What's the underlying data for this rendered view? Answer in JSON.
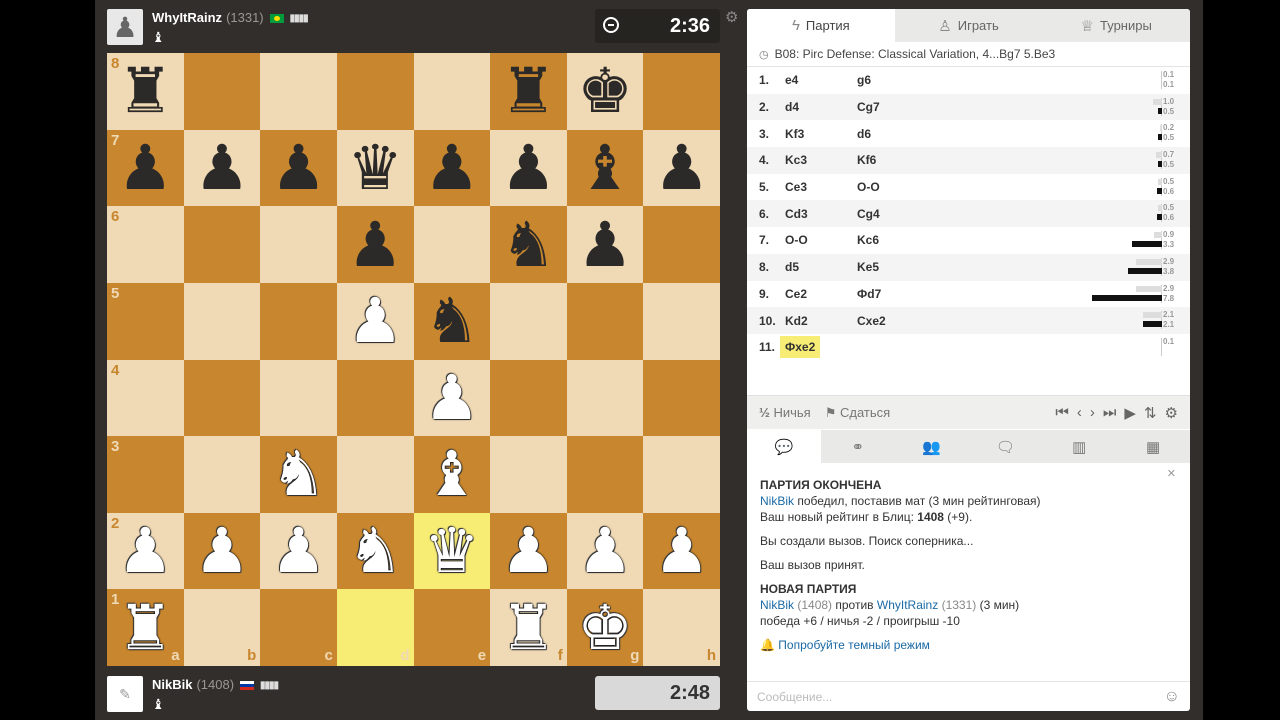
{
  "top_player": {
    "name": "WhyItRainz",
    "rating": "(1331)",
    "clock": "2:36"
  },
  "bottom_player": {
    "name": "NikBik",
    "rating": "(1408)",
    "clock": "2:48"
  },
  "board": {
    "ranks": [
      "8",
      "7",
      "6",
      "5",
      "4",
      "3",
      "2",
      "1"
    ],
    "files": [
      "a",
      "b",
      "c",
      "d",
      "e",
      "f",
      "g",
      "h"
    ],
    "rows": [
      [
        "bR",
        "",
        "",
        "",
        "",
        "bR",
        "bK",
        ""
      ],
      [
        "bP",
        "bP",
        "bP",
        "bQ",
        "bP",
        "bP",
        "bB",
        "bP"
      ],
      [
        "",
        "",
        "",
        "bP",
        "",
        "bN",
        "bP",
        ""
      ],
      [
        "",
        "",
        "",
        "wP",
        "bN",
        "",
        "",
        ""
      ],
      [
        "",
        "",
        "",
        "",
        "wP",
        "",
        "",
        ""
      ],
      [
        "",
        "",
        "wN",
        "",
        "wB",
        "",
        "",
        ""
      ],
      [
        "wP",
        "wP",
        "wP",
        "wN",
        "wQ",
        "wP",
        "wP",
        "wP"
      ],
      [
        "wR",
        "",
        "",
        "",
        "",
        "wR",
        "wK",
        ""
      ]
    ]
  },
  "panel": {
    "tabs": [
      "Партия",
      "Играть",
      "Турниры"
    ],
    "opening": "B08: Pirc Defense: Classical Variation, 4...Bg7 5.Be3",
    "moves": [
      {
        "no": "1.",
        "w": "e4",
        "b": "g6",
        "e1": "0.1",
        "e2": "0.1",
        "bw1": 0,
        "bw2": 0
      },
      {
        "no": "2.",
        "w": "d4",
        "b": "Cg7",
        "e1": "1.0",
        "e2": "0.5",
        "bw1": 10,
        "bw2": 5
      },
      {
        "no": "3.",
        "w": "Kf3",
        "b": "d6",
        "e1": "0.2",
        "e2": "0.5",
        "bw1": 2,
        "bw2": 5
      },
      {
        "no": "4.",
        "w": "Kc3",
        "b": "Kf6",
        "e1": "0.7",
        "e2": "0.5",
        "bw1": 7,
        "bw2": 5
      },
      {
        "no": "5.",
        "w": "Ce3",
        "b": "O-O",
        "e1": "0.5",
        "e2": "0.6",
        "bw1": 5,
        "bw2": 6
      },
      {
        "no": "6.",
        "w": "Cd3",
        "b": "Cg4",
        "e1": "0.5",
        "e2": "0.6",
        "bw1": 5,
        "bw2": 6
      },
      {
        "no": "7.",
        "w": "O-O",
        "b": "Kc6",
        "e1": "0.9",
        "e2": "3.3",
        "bw1": 9,
        "bw2": 33
      },
      {
        "no": "8.",
        "w": "d5",
        "b": "Ke5",
        "e1": "2.9",
        "e2": "3.8",
        "bw1": 29,
        "bw2": 38
      },
      {
        "no": "9.",
        "w": "Ce2",
        "b": "Фd7",
        "e1": "2.9",
        "e2": "7.8",
        "bw1": 29,
        "bw2": 78
      },
      {
        "no": "10.",
        "w": "Kd2",
        "b": "Cxe2",
        "e1": "2.1",
        "e2": "2.1",
        "bw1": 21,
        "bw2": 21
      },
      {
        "no": "11.",
        "w": "Фxe2",
        "b": "",
        "e1": "0.1",
        "e2": "",
        "bw1": 0,
        "bw2": 0
      }
    ],
    "draw_label": "Ничья",
    "resign_label": "Сдаться",
    "draw_symbol": "½"
  },
  "chat": {
    "game_over": "ПАРТИЯ ОКОНЧЕНА",
    "winner_name": "NikBik",
    "winner_text": " победил, поставив мат (3 мин рейтинговая)",
    "rating_text": "Ваш новый рейтинг в Блиц: ",
    "rating_value": "1408",
    "rating_delta": " (+9).",
    "challenge_created": "Вы создали вызов. Поиск соперника...",
    "challenge_accepted": "Ваш вызов принят.",
    "new_game": "НОВАЯ ПАРТИЯ",
    "p1": "NikBik",
    "p1_rating": " (1408) ",
    "vs": "против ",
    "p2": "WhyItRainz",
    "p2_rating": " (1331) ",
    "mode": "(3 мин)",
    "stats": "победа +6 / ничья -2 / проигрыш -10",
    "dark_mode": "Попробуйте темный режим",
    "placeholder": "Сообщение..."
  },
  "icons": {
    "tab_game": "lightning-icon",
    "tab_play": "pawn-icon",
    "tab_tournaments": "trophy-icon"
  }
}
